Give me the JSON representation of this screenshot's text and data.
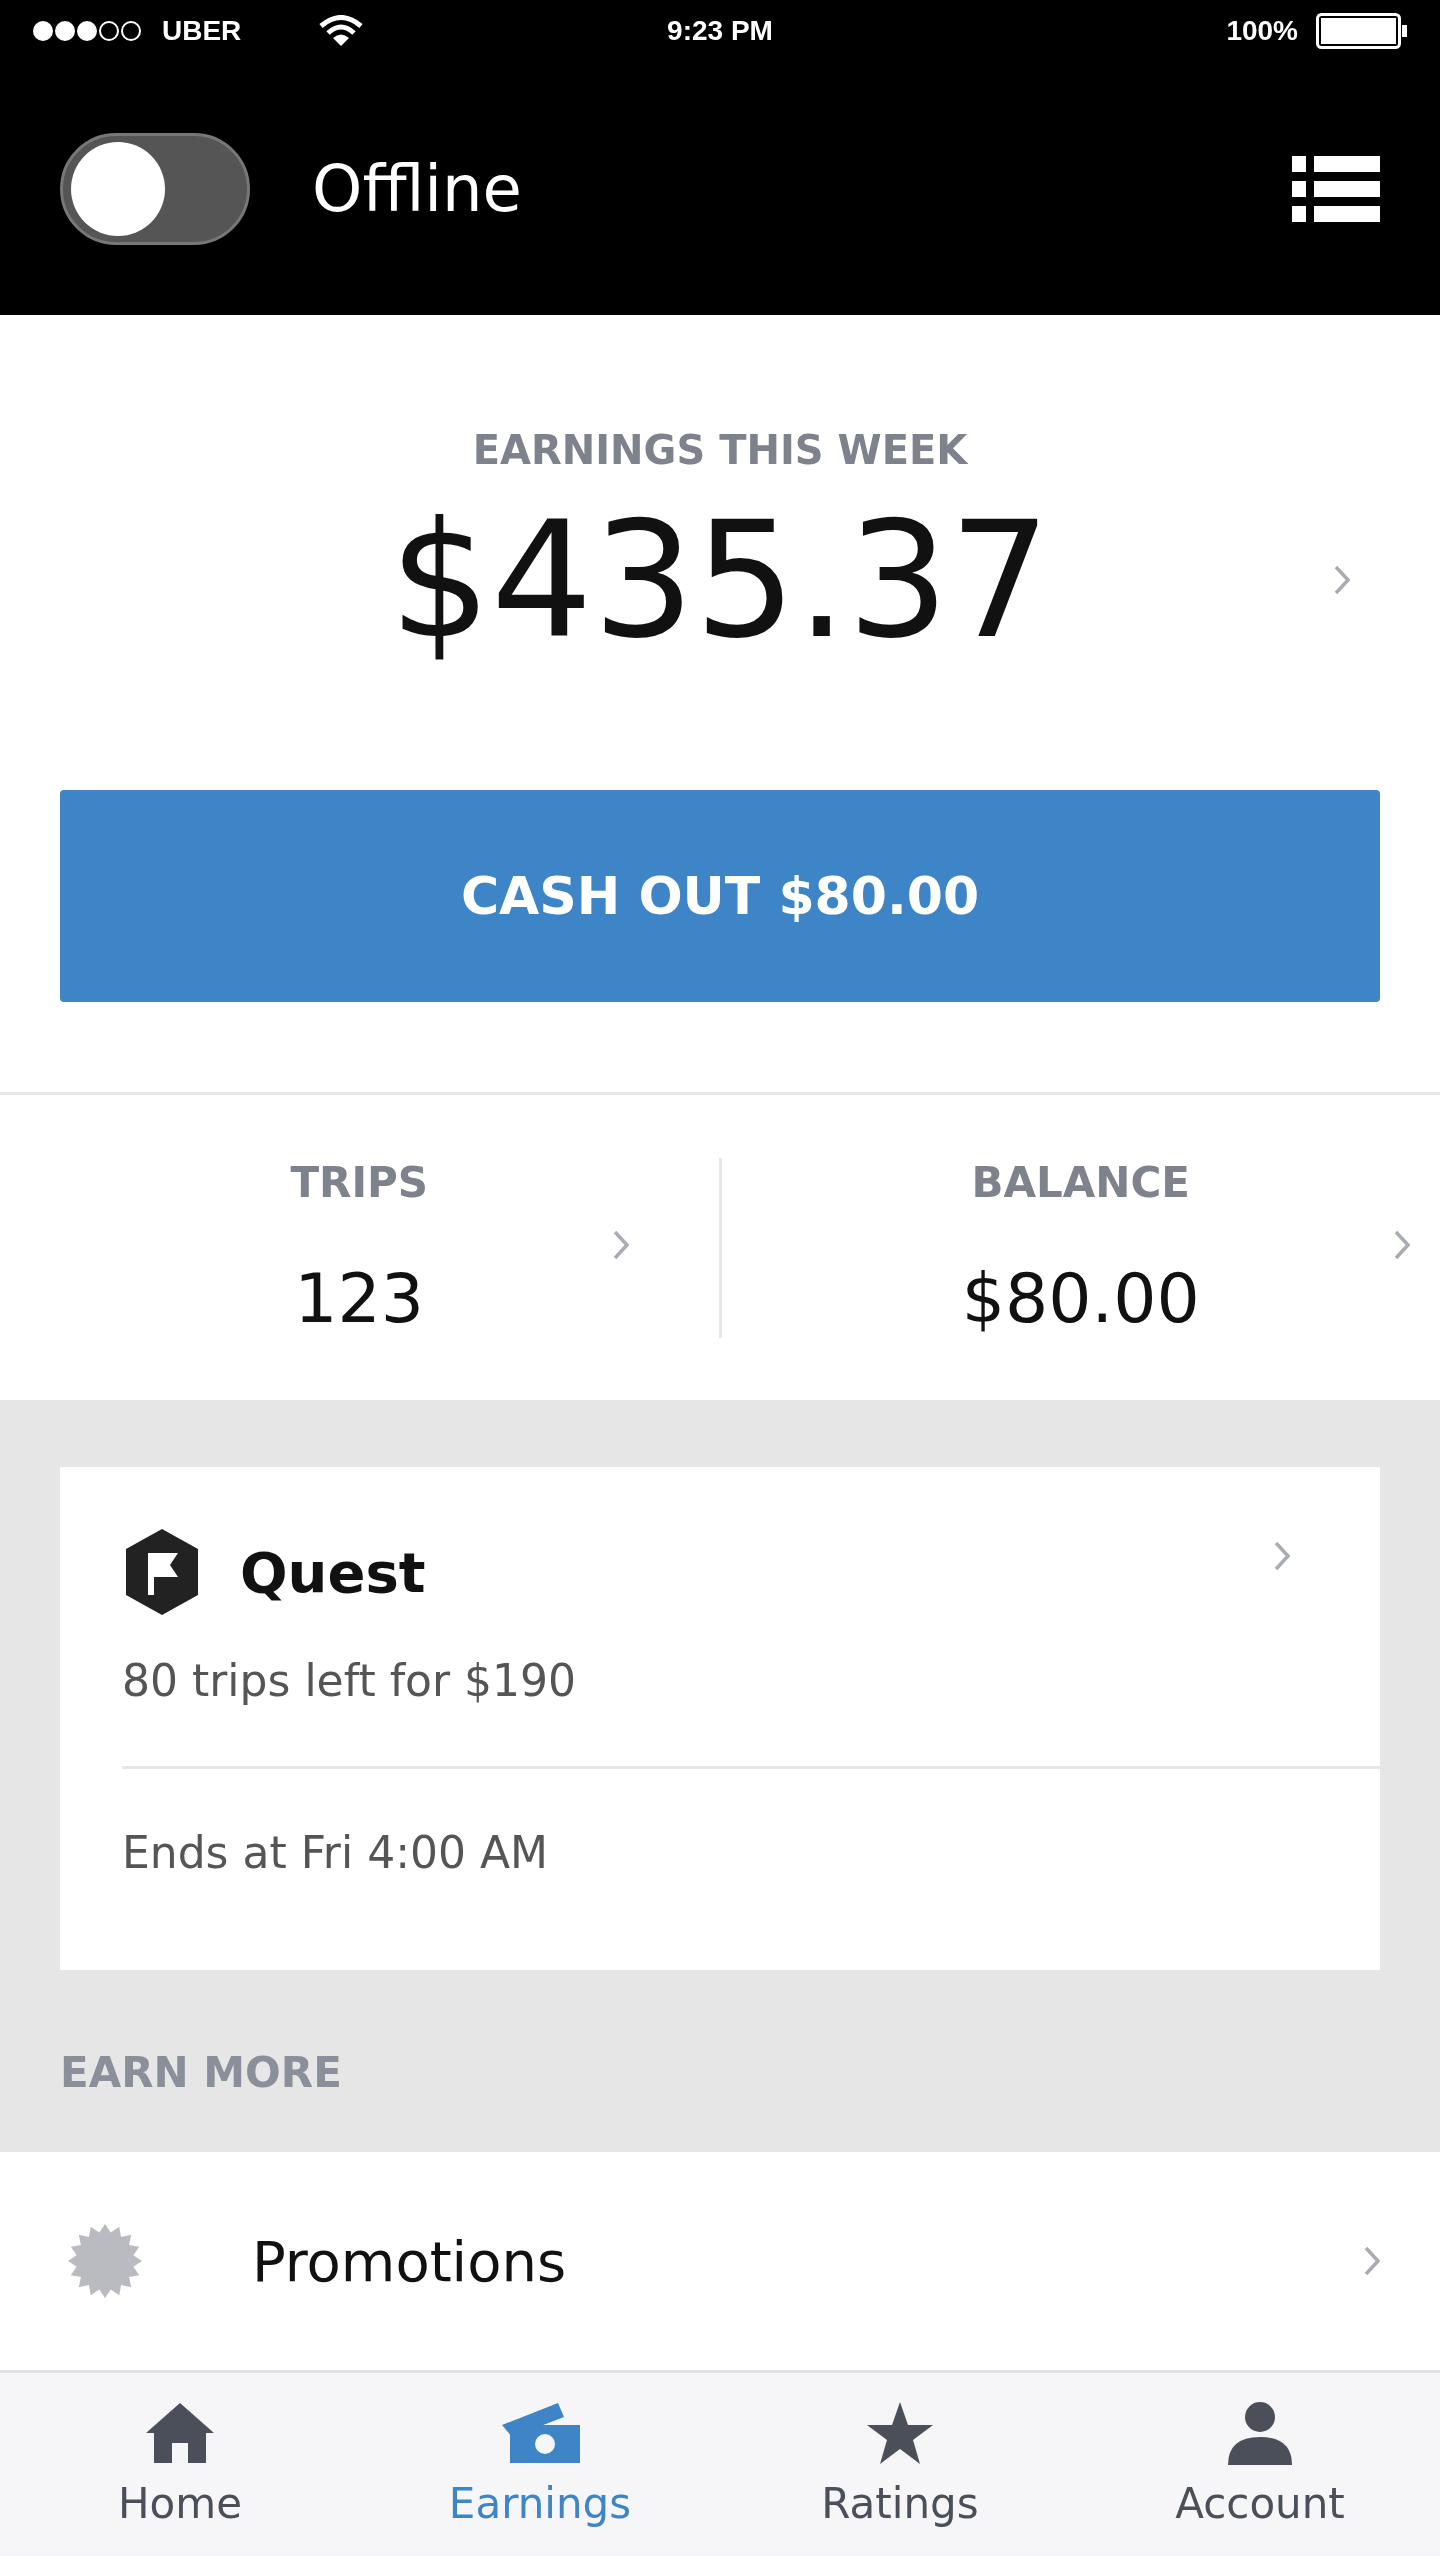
{
  "status_bar": {
    "carrier": "UBER",
    "time": "9:23 PM",
    "battery": "100%"
  },
  "header": {
    "online": false,
    "status": "Offline"
  },
  "earnings": {
    "label": "EARNINGS THIS WEEK",
    "amount": "$435.37"
  },
  "cash_out": {
    "label": "CASH OUT $80.00"
  },
  "stats": [
    {
      "label": "TRIPS",
      "value": "123"
    },
    {
      "label": "BALANCE",
      "value": "$80.00"
    }
  ],
  "quest": {
    "title": "Quest",
    "detail": "80 trips left for $190",
    "ends": "Ends at Fri 4:00 AM"
  },
  "earn_more": {
    "heading": "EARN MORE",
    "items": [
      {
        "title": "Promotions"
      }
    ]
  },
  "tabs": [
    {
      "label": "Home",
      "kind": "home",
      "selected": false
    },
    {
      "label": "Earnings",
      "kind": "earnings",
      "selected": true
    },
    {
      "label": "Ratings",
      "kind": "ratings",
      "selected": false
    },
    {
      "label": "Account",
      "kind": "account",
      "selected": false
    }
  ]
}
